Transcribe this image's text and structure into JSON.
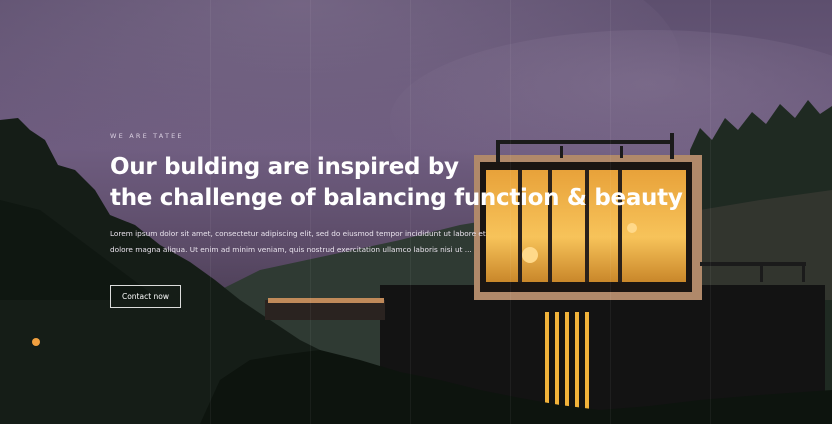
{
  "hero": {
    "eyebrow": "WE ARE TATEE",
    "headline_line1": "Our bulding are inspired by",
    "headline_line2": "the challenge of balancing function & beauty",
    "description": "Lorem ipsum dolor sit amet, consectetur adipiscing elit, sed do eiusmod tempor incididunt ut labore et dolore magna aliqua. Ut enim ad minim veniam, quis nostrud exercitation ullamco laboris nisi ut ...",
    "cta_label": "Contact now"
  },
  "colors": {
    "sky": "#6a5a7a",
    "window_glow": "#f0b23a",
    "text": "#ffffff"
  }
}
